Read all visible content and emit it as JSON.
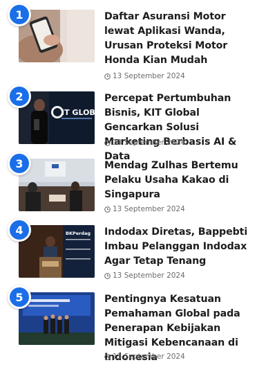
{
  "articles": [
    {
      "rank": "1",
      "title": "Daftar Asuransi Motor lewat Aplikasi Wanda, Urusan Proteksi Motor Honda Kian Mudah",
      "date": "13 September 2024",
      "thumb_icon": "phone-hand-photo"
    },
    {
      "rank": "2",
      "title": "Percepat Pertumbuhan Bisnis, KIT Global Gencarkan Solusi Marketing Berbasis AI & Data",
      "date": "13 September 2024",
      "thumb_icon": "speaker-stage-photo",
      "thumb_text": "IT GLOBAL"
    },
    {
      "rank": "3",
      "title": "Mendag Zulhas Bertemu Pelaku Usaha Kakao di Singapura",
      "date": "13 September 2024",
      "thumb_icon": "meeting-room-photo"
    },
    {
      "rank": "4",
      "title": "Indodax Diretas, Bappebti Imbau Pelanggan Indodax Agar Tetap Tenang",
      "date": "13 September 2024",
      "thumb_icon": "podium-speaker-photo",
      "thumb_text": "BKPerdag"
    },
    {
      "rank": "5",
      "title": "Pentingnya Kesatuan Pemahaman Global pada Penerapan Kebijakan Mitigasi Kebencanaan di Indonesia",
      "date": "13 September 2024",
      "thumb_icon": "group-stage-photo"
    }
  ],
  "colors": {
    "badge": "#1a6fe8",
    "title": "#1d1d1d",
    "date": "#6b6b6b"
  }
}
